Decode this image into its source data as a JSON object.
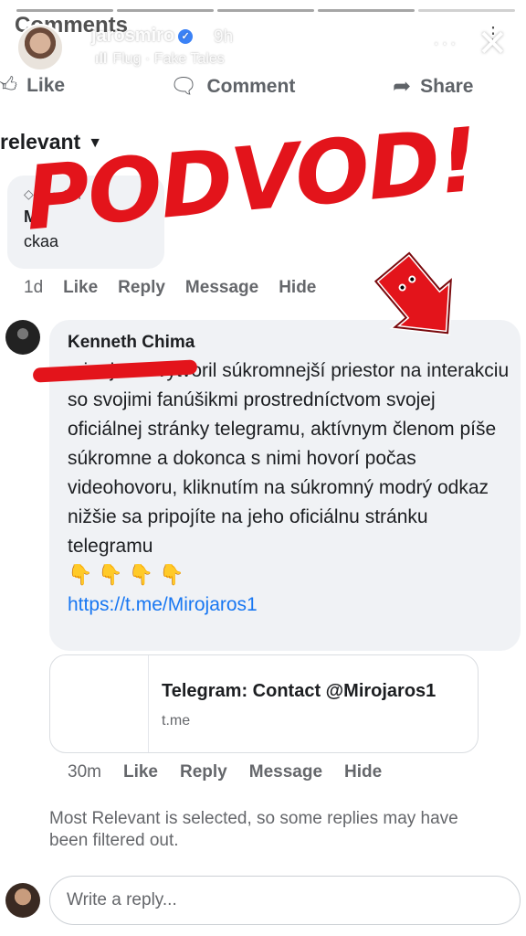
{
  "story": {
    "username": "jarosmiro",
    "time": "9h",
    "music": "Flug · Fake Tales",
    "comments_title": "Comments"
  },
  "actions": {
    "like": "Like",
    "comment": "Comment",
    "share": "Share"
  },
  "sort_label": "relevant",
  "overlay_text": "PODVOD!",
  "comment1": {
    "badge": "Top fan",
    "name": "M",
    "text": "ckaa",
    "time": "1d",
    "like": "Like",
    "reply": "Reply",
    "message": "Message",
    "hide": "Hide"
  },
  "comment2": {
    "name": "Kenneth Chima",
    "text": "miro jaros vytvoril súkromnejší priestor na interakciu so svojimi fanúšikmi prostredníctvom svojej oficiálnej stránky telegramu, aktívnym členom píše súkromne a dokonca s nimi hovorí počas videohovoru, kliknutím na súkromný modrý odkaz nižšie sa pripojíte na jeho oficiálnu stránku telegramu",
    "emojis": "👇👇👇👇",
    "link": "https://t.me/Mirojaros1",
    "preview_title": "Telegram: Contact @Mirojaros1",
    "preview_domain": "t.me",
    "time": "30m",
    "like": "Like",
    "reply": "Reply",
    "message": "Message",
    "hide": "Hide"
  },
  "filter_note": "Most Relevant is selected, so some replies may have been filtered out.",
  "reply_placeholder": "Write a reply..."
}
